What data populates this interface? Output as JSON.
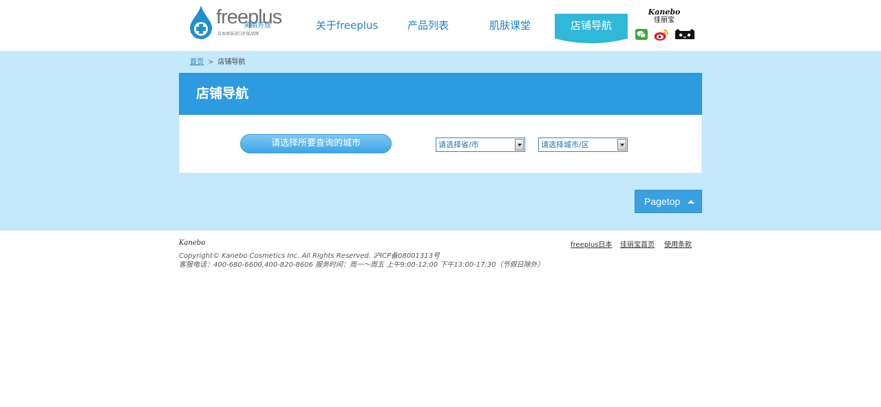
{
  "header": {
    "logo": {
      "brand": "freeplus",
      "brand_cn": "芙丽芳丝",
      "tagline": "日本原装进口护肤品牌"
    },
    "nav": [
      {
        "label": "关于freeplus"
      },
      {
        "label": "产品列表"
      },
      {
        "label": "肌肤课堂"
      },
      {
        "label": "店铺导航",
        "active": true
      }
    ],
    "kanebo": {
      "en": "Kanebo",
      "cn": "佳丽宝"
    },
    "social_icons": [
      "wechat-icon",
      "weibo-icon",
      "tmall-icon"
    ]
  },
  "breadcrumb": {
    "home": "首页",
    "separator": ">",
    "current": "店铺导航"
  },
  "panel": {
    "title": "店铺导航",
    "city_button": "请选择所要查询的城市",
    "province_select": "请选择省/市",
    "city_select": "请选择城市/区"
  },
  "pagetop": {
    "label": "Pagetop"
  },
  "footer": {
    "logo": "Kanebo",
    "copyright": "Copyright© Kanebo Cosmetics Inc. All Rights Reserved. 沪ICP备08001313号",
    "service": "客服电话：400-680-6600,400-820-8606 服务时间：周一～周五 上午9:00-12:00 下午13:00-17:30（节假日除外）",
    "links": [
      "freeplus日本",
      "佳丽宝首页",
      "使用条款"
    ]
  },
  "colors": {
    "accent": "#2d9be0",
    "nav_text": "#1f82c6",
    "active_tab": "#2fb8d8",
    "main_bg": "#c3e9fa"
  }
}
